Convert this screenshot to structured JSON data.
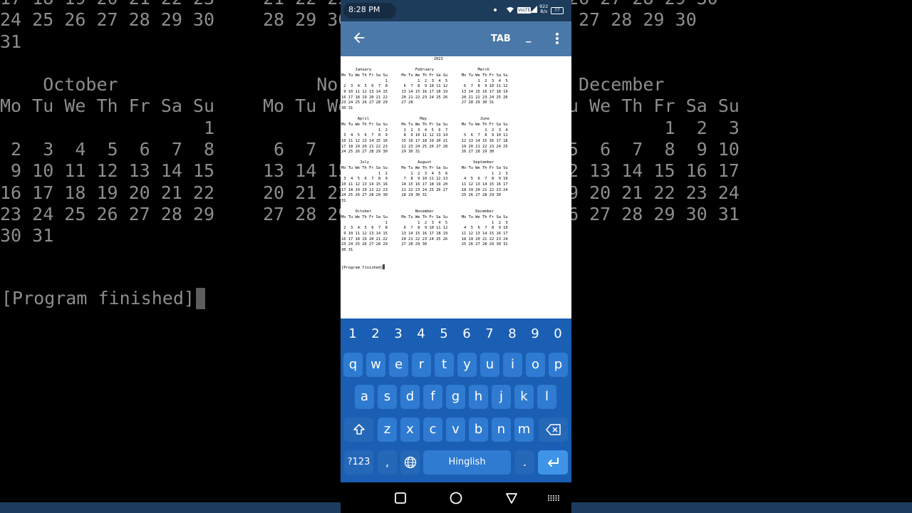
{
  "background": {
    "left_block": "17 18 19 20 21 22 23\n24 25 26 27 28 29 30\n31\n\n    October\nMo Tu We Th Fr Sa Su\n                   1\n 2  3  4  5  6  7  8\n 9 10 11 12 13 14 15\n16 17 18 19 20 21 22\n23 24 25 26 27 28 29\n30 31",
    "mid_block": "21 22 23\n28 29 30\n\n\n     No\nMo Tu We\n\n 6  7\n13 14 15\n20 21 22\n27 28 29",
    "right_block": "26 27 28 29 30\n 27 28 29 30\n\n\n December\nu We Th Fr Sa Su\n         1  2  3\n5  6  7  8  9 10\n2 13 14 15 16 17\n9 20 21 22 23 24\n6 27 28 29 30 31",
    "finished": "[Program finished]"
  },
  "status_bar": {
    "time": "8:28 PM",
    "volte": "VoLTE",
    "speed_value": "922",
    "speed_unit": "B/s",
    "battery": "77"
  },
  "app_bar": {
    "tab_label": "TAB",
    "underscore_label": "_"
  },
  "terminal": {
    "calendar_text": "                                        2023\n\n      January                   February                   March\nMo Tu We Th Fr Sa Su      Mo Tu We Th Fr Sa Su      Mo Tu We Th Fr Sa Su\n                   1             1  2  3  4  5             1  2  3  4  5\n 2  3  4  5  6  7  8       6  7  8  9 10 11 12       6  7  8  9 10 11 12\n 9 10 11 12 13 14 15      13 14 15 16 17 18 19      13 14 15 16 17 18 19\n16 17 18 19 20 21 22      20 21 22 23 24 25 26      20 21 22 23 24 25 26\n23 24 25 26 27 28 29      27 28                     27 28 29 30 31\n30 31\n\n       April                      May                       June\nMo Tu We Th Fr Sa Su      Mo Tu We Th Fr Sa Su      Mo Tu We Th Fr Sa Su\n                1  2       1  2  3  4  5  6  7                1  2  3  4\n 3  4  5  6  7  8  9       8  9 10 11 12 13 14       5  6  7  8  9 10 11\n10 11 12 13 14 15 16      15 16 17 18 19 20 21      12 13 14 15 16 17 18\n17 18 19 20 21 22 23      22 23 24 25 26 27 28      19 20 21 22 23 24 25\n24 25 26 27 28 29 30      29 30 31                  26 27 28 29 30\n\n        July                     August                  September\nMo Tu We Th Fr Sa Su      Mo Tu We Th Fr Sa Su      Mo Tu We Th Fr Sa Su\n                1  2          1  2  3  4  5  6                   1  2  3\n 3  4  5  6  7  8  9       7  8  9 10 11 12 13       4  5  6  7  8  9 10\n10 11 12 13 14 15 16      14 15 16 17 18 19 20      11 12 13 14 15 16 17\n17 18 19 20 21 22 23      21 22 23 24 25 26 27      18 19 20 21 22 23 24\n24 25 26 27 28 29 30      28 29 30 31               25 26 27 28 29 30\n31\n\n      October                   November                  December\nMo Tu We Th Fr Sa Su      Mo Tu We Th Fr Sa Su      Mo Tu We Th Fr Sa Su\n                   1             1  2  3  4  5                   1  2  3\n 2  3  4  5  6  7  8       6  7  8  9 10 11 12       4  5  6  7  8  9 10\n 9 10 11 12 13 14 15      13 14 15 16 17 18 19      11 12 13 14 15 16 17\n16 17 18 19 20 21 22      20 21 22 23 24 25 26      18 19 20 21 22 23 24\n23 24 25 26 27 28 29      27 28 29 30               25 26 27 28 29 30 31\n30 31",
    "finished_text": "[Program finished]"
  },
  "keyboard": {
    "numbers": [
      "1",
      "2",
      "3",
      "4",
      "5",
      "6",
      "7",
      "8",
      "9",
      "0"
    ],
    "row1": [
      "q",
      "w",
      "e",
      "r",
      "t",
      "y",
      "u",
      "i",
      "o",
      "p"
    ],
    "row2": [
      "a",
      "s",
      "d",
      "f",
      "g",
      "h",
      "j",
      "k",
      "l"
    ],
    "row3": [
      "z",
      "x",
      "c",
      "v",
      "b",
      "n",
      "m"
    ],
    "symbols_label": "?123",
    "comma_label": ",",
    "space_label": "Hinglish",
    "period_label": "."
  },
  "colors": {
    "app_bar": "#4a78a8",
    "keyboard": "#1a5fb4",
    "key": "#2f7bd1",
    "enter_key": "#3f94e8"
  }
}
